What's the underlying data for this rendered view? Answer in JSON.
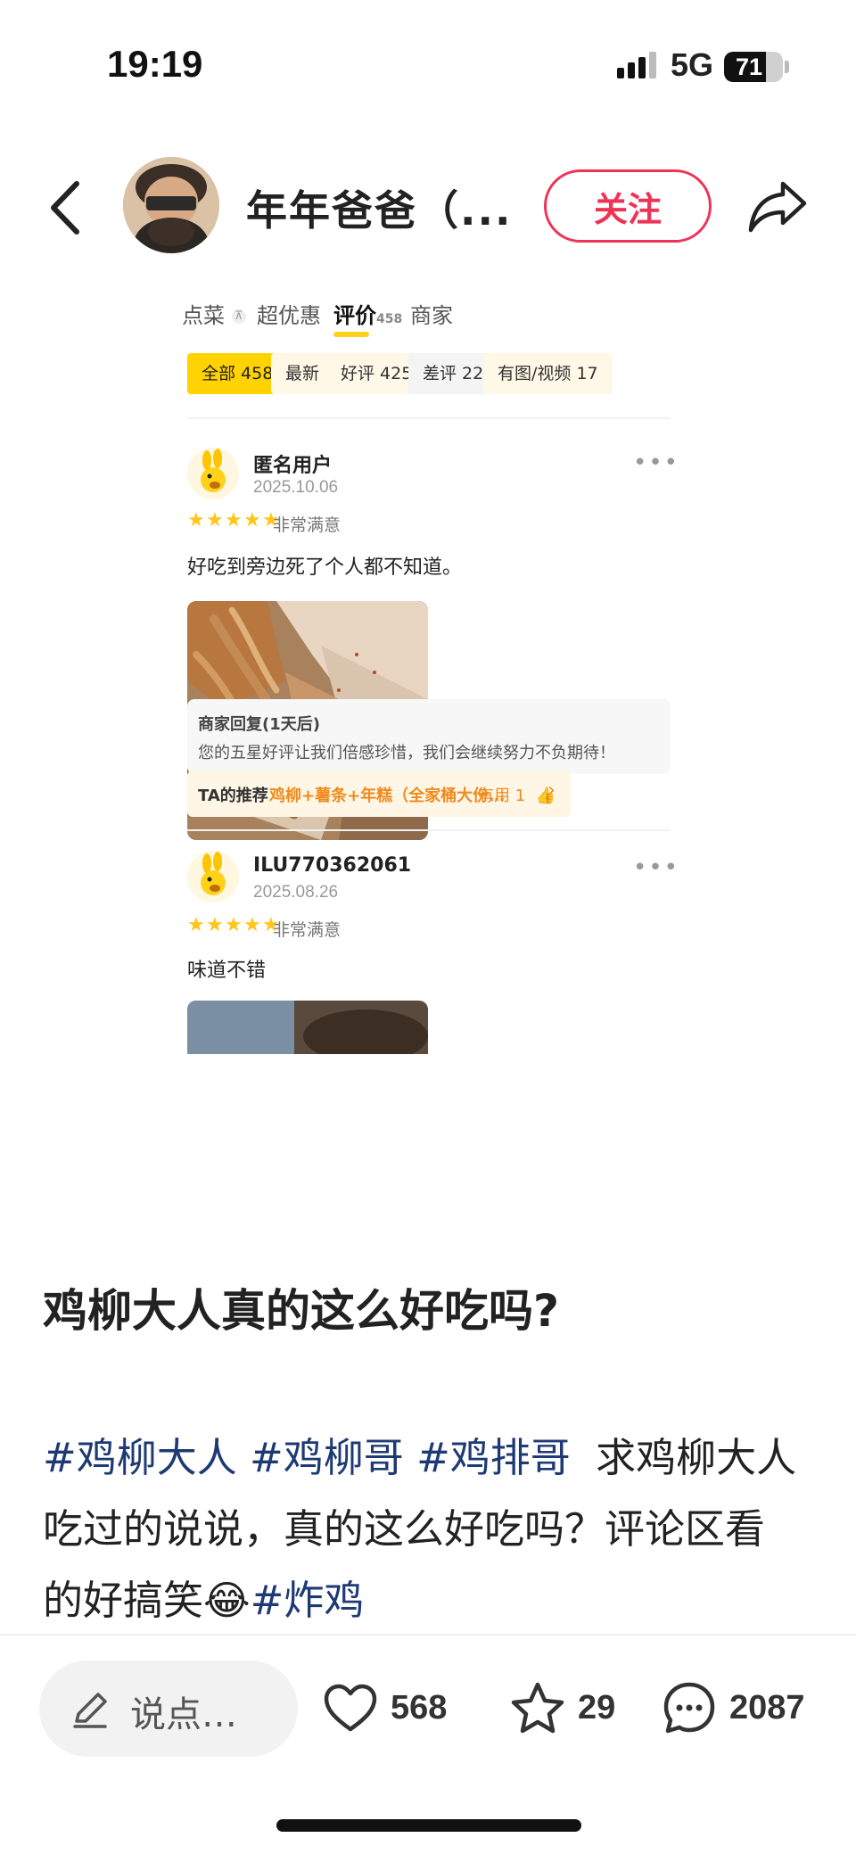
{
  "status_bar": {
    "time": "19:19",
    "network": "5G",
    "battery": "71",
    "battery_level": 0.71
  },
  "header": {
    "username": "年年爸爸（...",
    "follow_label": "关注"
  },
  "screenshot": {
    "tabs": [
      {
        "label": "点菜",
        "badge": ""
      },
      {
        "label": "超优惠",
        "badge": ""
      },
      {
        "label": "评价",
        "badge": "458"
      },
      {
        "label": "商家",
        "badge": ""
      }
    ],
    "filters": [
      "全部 458",
      "最新",
      "好评 425",
      "差评 22",
      "有图/视频 17"
    ],
    "reviews": [
      {
        "user": "匿名用户",
        "date": "2025.10.06",
        "rating_text": "非常满意",
        "stars": 5,
        "text": "好吃到旁边死了个人都不知道。",
        "reply_title": "商家回复(1天后)",
        "reply_body": "您的五星好评让我们倍感珍惜，我们会继续努力不负期待！",
        "rec_label": "TA的推荐",
        "rec_value": "鸡柳+薯条+年糕（全家桶大份…",
        "useful": "有用 1"
      },
      {
        "user": "ILU770362061",
        "date": "2025.08.26",
        "rating_text": "非常满意",
        "stars": 5,
        "text": "味道不错"
      }
    ]
  },
  "post": {
    "title": "鸡柳大人真的这么好吃吗?",
    "tags": [
      "#鸡柳大人",
      "#鸡柳哥",
      "#鸡排哥"
    ],
    "body_part1": "求鸡柳大人",
    "body_part2": "吃过的说说，真的这么好吃吗？评论区看",
    "body_part3": "的好搞笑",
    "emoji": "😂",
    "tag_end": "#炸鸡"
  },
  "bottom_bar": {
    "comment_placeholder": "说点…",
    "likes": "568",
    "favorites": "29",
    "comments": "2087"
  },
  "colors": {
    "follow": "#ee3355",
    "tag": "#1e3a74",
    "accent_yellow": "#ffd200",
    "orange": "#f08a1c"
  }
}
